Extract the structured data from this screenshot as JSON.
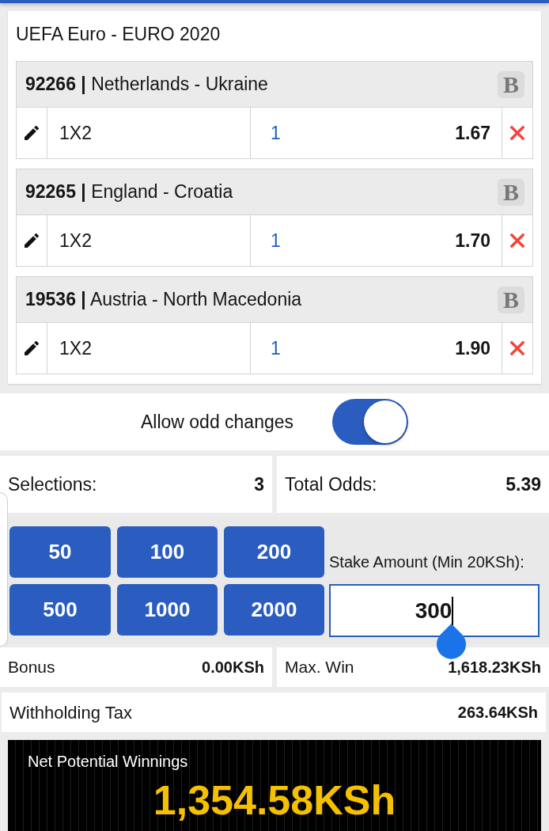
{
  "competition": {
    "title": "UEFA Euro - EURO 2020"
  },
  "events": [
    {
      "title": "**92266 |** Netherlands - Ukraine",
      "badge": "B",
      "market": "1X2",
      "pick": "1",
      "odds": "1.67"
    },
    {
      "title": "**92265 |** England - Croatia",
      "badge": "B",
      "market": "1X2",
      "pick": "1",
      "odds": "1.70"
    },
    {
      "title": "**19536 |** Austria - North Macedonia",
      "badge": "B",
      "market": "1X2",
      "pick": "1",
      "odds": "1.90"
    }
  ],
  "odd_changes": {
    "label": "Allow odd changes",
    "on": true
  },
  "summary": [
    {
      "label": "Selections:",
      "value": "3"
    },
    {
      "label": "Total Odds:",
      "value": "5.39"
    }
  ],
  "quick_stakes": [
    "50",
    "100",
    "200",
    "500",
    "1000",
    "2000"
  ],
  "stake": {
    "label": "Stake Amount (Min 20KSh):",
    "value": "300"
  },
  "totals": [
    {
      "label": "Bonus",
      "value": "0.00KSh"
    },
    {
      "label": "Max. Win",
      "value": "1,618.23KSh"
    }
  ],
  "tax": {
    "label": "Withholding Tax",
    "value": "263.64KSh"
  },
  "net_winnings": {
    "label": "Net Potential Winnings",
    "value": "1,354.58KSh"
  }
}
